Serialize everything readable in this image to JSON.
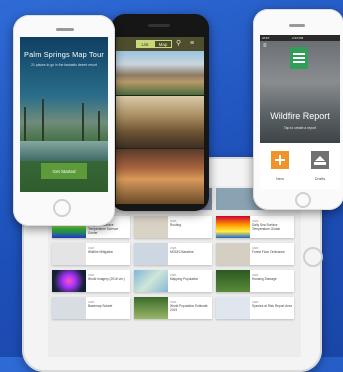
{
  "phone_left": {
    "title": "Palm Springs Map Tour",
    "subtitle": "21 places to go in the fantastic desert resort",
    "button_label": "Get Started"
  },
  "phone_middle": {
    "tabs": [
      {
        "label": "List"
      },
      {
        "label": "Map"
      }
    ],
    "accent_color": "#c9d97a"
  },
  "phone_right": {
    "status_carrier": "AT&T",
    "status_time": "2:23 PM",
    "title": "Wildfire Report",
    "subtitle": "Tap to create a report",
    "tiles": [
      {
        "label": "New",
        "icon": "plus-document-icon",
        "color": "#f0932b"
      },
      {
        "label": "Drafts",
        "icon": "inbox-tray-icon",
        "color": "#707070"
      }
    ]
  },
  "tablet": {
    "cards": [
      {
        "meta": "WEB",
        "text": "Daily Sea Surface Temperature Science Center",
        "thumb": "#1a2a8a"
      },
      {
        "meta": "WEB",
        "text": "Routing",
        "thumb": "#d8d2c4"
      },
      {
        "meta": "WEB",
        "text": "Daily Sea Surface Temperature Global",
        "thumb": "#c04028"
      },
      {
        "meta": "WEB",
        "text": "Wildfire Mitigation",
        "thumb": "#e0e0e0"
      },
      {
        "meta": "WEB",
        "text": "MODIS Baseline",
        "thumb": "#cdd7e2"
      },
      {
        "meta": "WEB",
        "text": "Forest Floor Ordinance",
        "thumb": "#d4cfc2"
      },
      {
        "meta": "WEB",
        "text": "World Imagery (2016 ver.)",
        "thumb": "#3a2a4a"
      },
      {
        "meta": "WEB",
        "text": "Mapping Population",
        "thumb": "#7fb7d8"
      },
      {
        "meta": "WEB",
        "text": "Housing Damage",
        "thumb": "#3a6a2a"
      },
      {
        "meta": "WEB",
        "text": "Basemap Subset",
        "thumb": "#d8dde3"
      },
      {
        "meta": "WEB",
        "text": "World Population Estimate 2015",
        "thumb": "#5a8a3a"
      },
      {
        "meta": "WEB",
        "text": "Species at Risk Report Area",
        "thumb": "#dfe6ee"
      }
    ]
  }
}
